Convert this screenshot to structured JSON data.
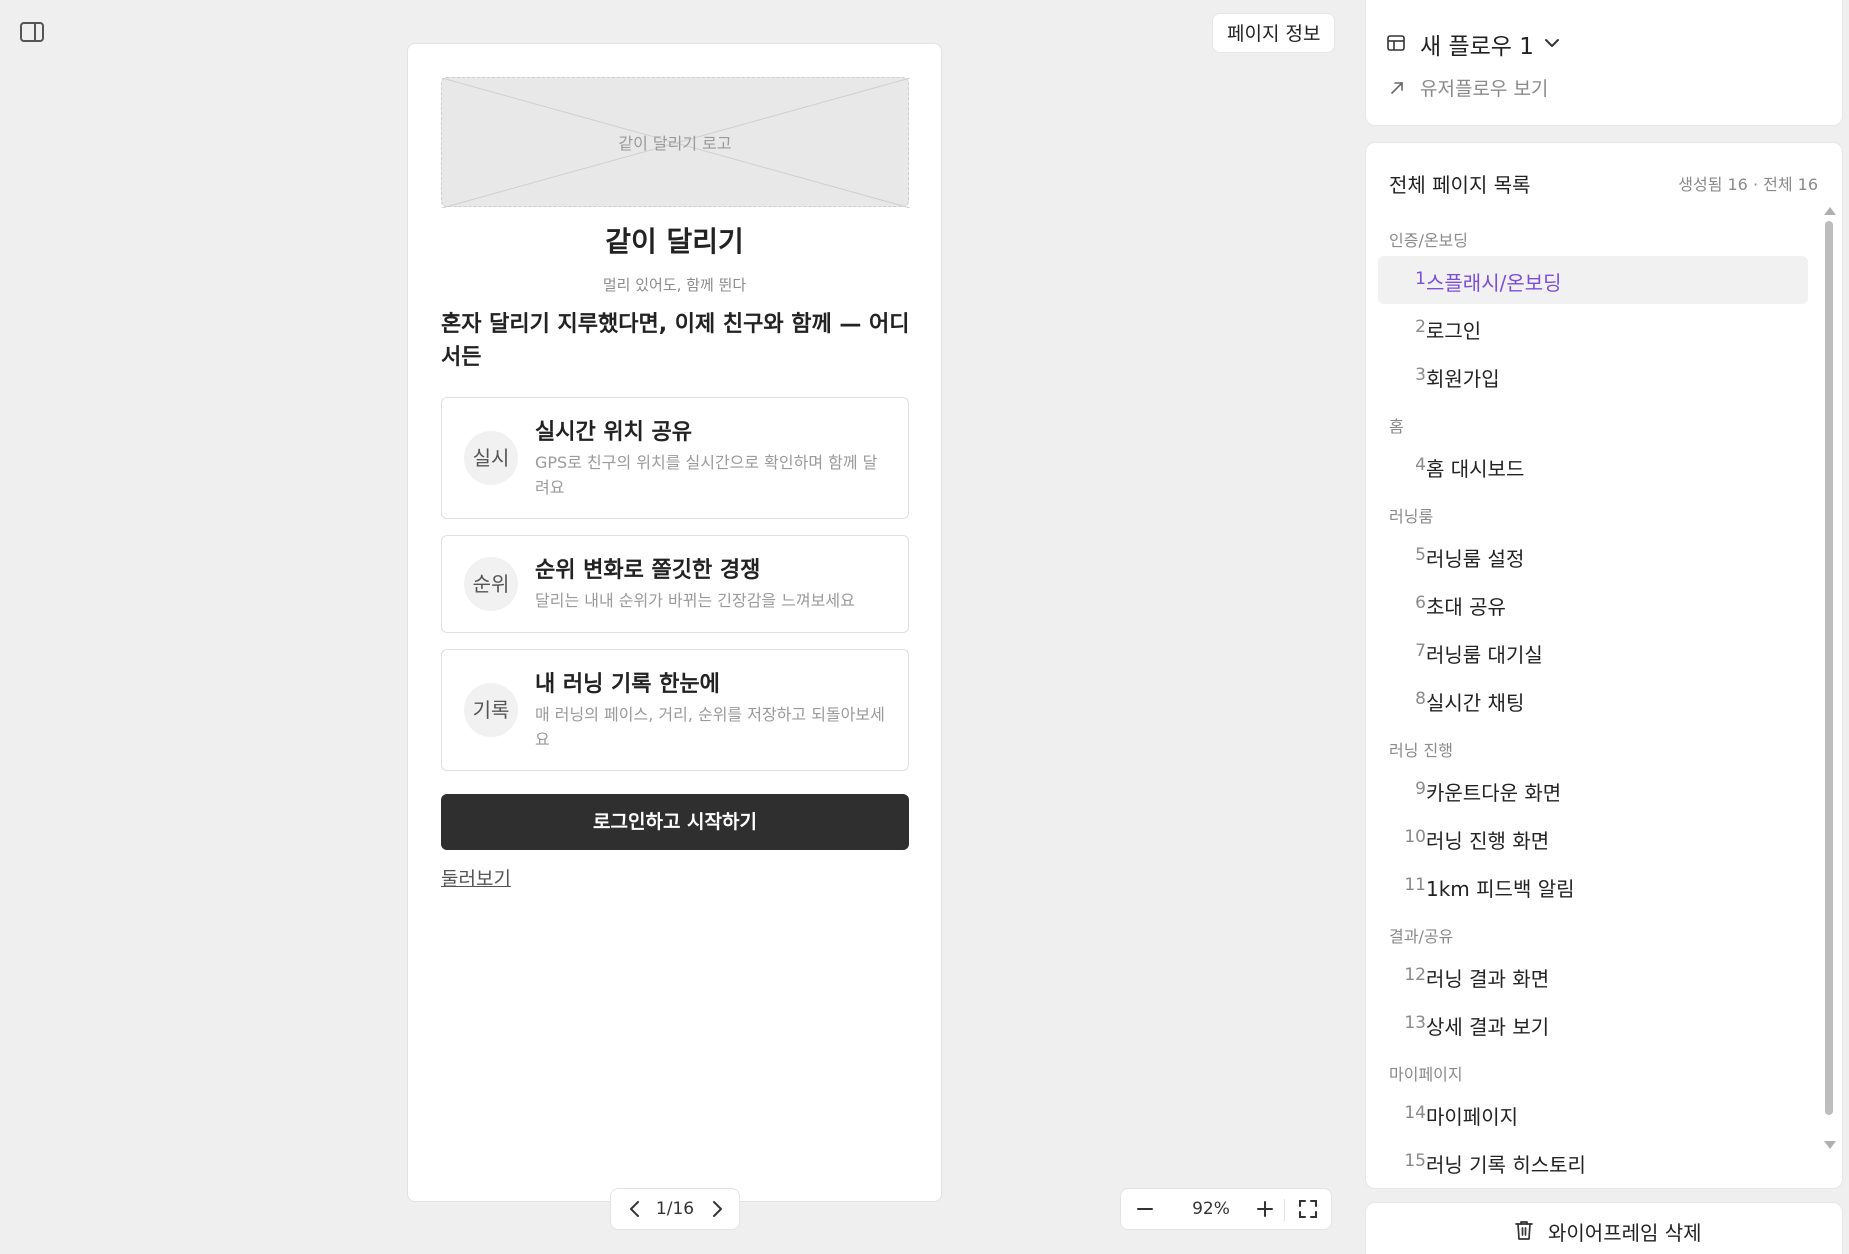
{
  "toolbar": {
    "page_info_label": "페이지 정보"
  },
  "phone": {
    "logo_placeholder": "같이 달리기 로고",
    "title": "같이 달리기",
    "tagline": "멀리 있어도, 함께 뛴다",
    "headline": "혼자 달리기 지루했다면, 이제 친구와 함께 — 어디서든",
    "features": [
      {
        "badge": "실시",
        "title": "실시간 위치 공유",
        "desc": "GPS로 친구의 위치를 실시간으로 확인하며 함께 달려요"
      },
      {
        "badge": "순위",
        "title": "순위 변화로 쫄깃한 경쟁",
        "desc": "달리는 내내 순위가 바뀌는 긴장감을 느껴보세요"
      },
      {
        "badge": "기록",
        "title": "내 러닝 기록 한눈에",
        "desc": "매 러닝의 페이스, 거리, 순위를 저장하고 되돌아보세요"
      }
    ],
    "start_button": "로그인하고 시작하기",
    "browse_link": "둘러보기"
  },
  "pager": {
    "label": "1/16"
  },
  "zoom": {
    "label": "92%"
  },
  "flow": {
    "title": "새 플로우 1",
    "userflow_link": "유저플로우 보기"
  },
  "pages": {
    "heading": "전체 페이지 목록",
    "stats": "생성됨 16 · 전체 16",
    "groups": [
      {
        "label": "인증/온보딩"
      },
      {
        "label": "홈"
      },
      {
        "label": "러닝룸"
      },
      {
        "label": "러닝 진행"
      },
      {
        "label": "결과/공유"
      },
      {
        "label": "마이페이지"
      }
    ],
    "items": [
      {
        "num": "1",
        "name": "스플래시/온보딩"
      },
      {
        "num": "2",
        "name": "로그인"
      },
      {
        "num": "3",
        "name": "회원가입"
      },
      {
        "num": "4",
        "name": "홈 대시보드"
      },
      {
        "num": "5",
        "name": "러닝룸 설정"
      },
      {
        "num": "6",
        "name": "초대 공유"
      },
      {
        "num": "7",
        "name": "러닝룸 대기실"
      },
      {
        "num": "8",
        "name": "실시간 채팅"
      },
      {
        "num": "9",
        "name": "카운트다운 화면"
      },
      {
        "num": "10",
        "name": "러닝 진행 화면"
      },
      {
        "num": "11",
        "name": "1km 피드백 알림"
      },
      {
        "num": "12",
        "name": "러닝 결과 화면"
      },
      {
        "num": "13",
        "name": "상세 결과 보기"
      },
      {
        "num": "14",
        "name": "마이페이지"
      },
      {
        "num": "15",
        "name": "러닝 기록 히스토리"
      }
    ]
  },
  "footer": {
    "delete_label": "와이어프레임 삭제"
  },
  "colors": {
    "accent": "#7c4ddb",
    "primary_button": "#2f2f2f",
    "canvas_bg": "#efefef"
  }
}
